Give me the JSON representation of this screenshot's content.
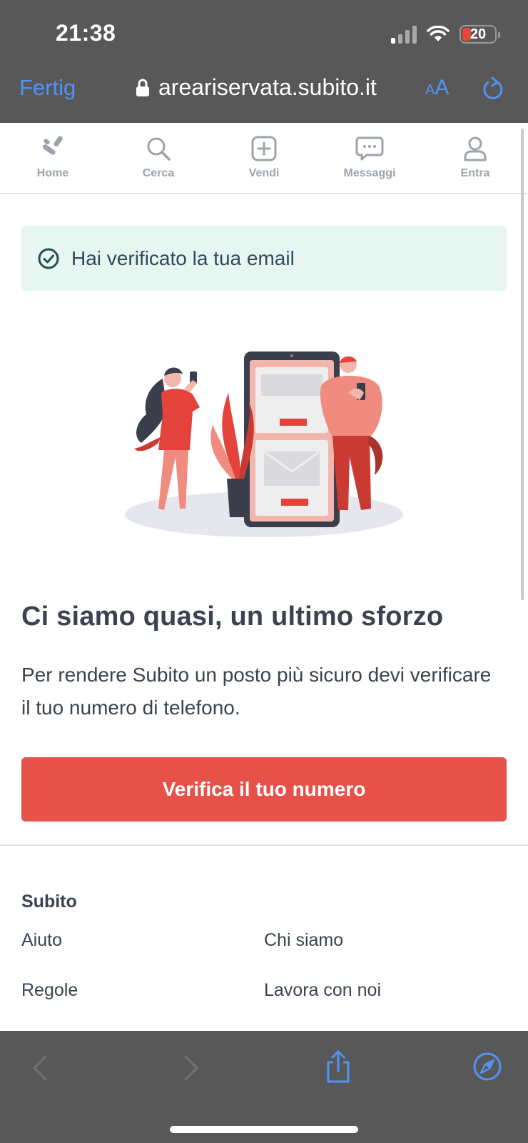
{
  "status_bar": {
    "time": "21:38",
    "battery": "20"
  },
  "browser": {
    "done_label": "Fertig",
    "url": "areariservata.subito.it",
    "text_size_label": "AA",
    "done_color": "#4f94f6"
  },
  "nav": {
    "items": [
      {
        "label": "Home",
        "icon": "home-logo-icon"
      },
      {
        "label": "Cerca",
        "icon": "search-icon"
      },
      {
        "label": "Vendi",
        "icon": "plus-square-icon"
      },
      {
        "label": "Messaggi",
        "icon": "chat-bubble-icon"
      },
      {
        "label": "Entra",
        "icon": "user-icon"
      }
    ]
  },
  "banner": {
    "text": "Hai verificato la tua email",
    "icon": "check-circle-icon",
    "color": "#e8f6f2"
  },
  "main": {
    "title": "Ci siamo quasi, un ultimo sforzo",
    "description": "Per rendere Subito un posto più sicuro devi verificare il tuo numero di telefono.",
    "cta_label": "Verifica il tuo numero",
    "cta_color": "#e6514a"
  },
  "footer": {
    "heading": "Subito",
    "links": [
      "Aiuto",
      "Chi siamo",
      "Regole",
      "Lavora con noi"
    ]
  }
}
